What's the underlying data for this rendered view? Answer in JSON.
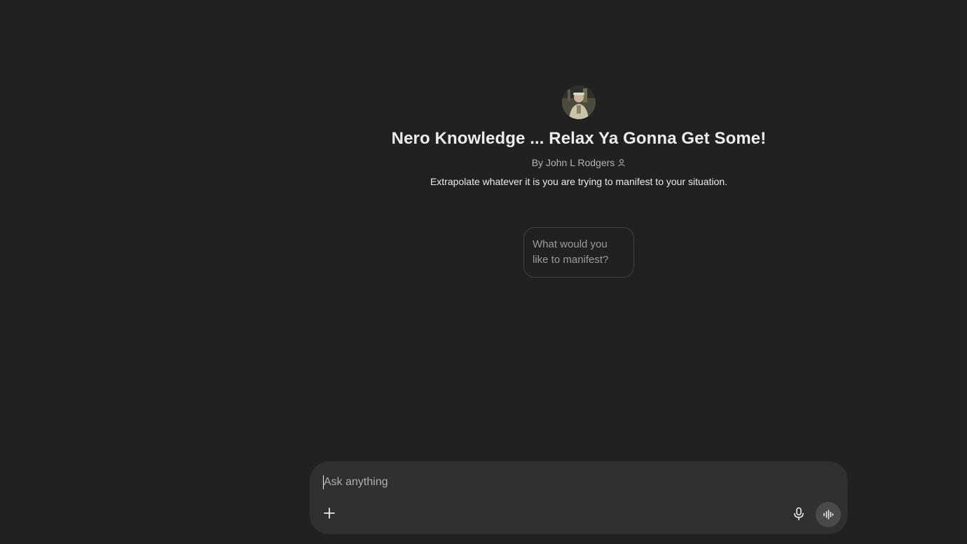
{
  "gpt": {
    "title": "Nero Knowledge ... Relax Ya Gonna Get Some!",
    "byline": "By John L Rodgers",
    "description": "Extrapolate whatever it is you are trying to manifest to your situation.",
    "avatar_icon": "avatar-photo",
    "starters": [
      "What would you like to manifest?"
    ]
  },
  "composer": {
    "placeholder": "Ask anything",
    "value": "",
    "plus_icon": "plus-icon",
    "mic_icon": "microphone-icon",
    "voice_icon": "voice-mode-icon"
  },
  "colors": {
    "background": "#212121",
    "composer_background": "#303030",
    "text": "#ececec",
    "muted_text": "#b4b4b4",
    "voice_button": "#4a4a4a"
  }
}
